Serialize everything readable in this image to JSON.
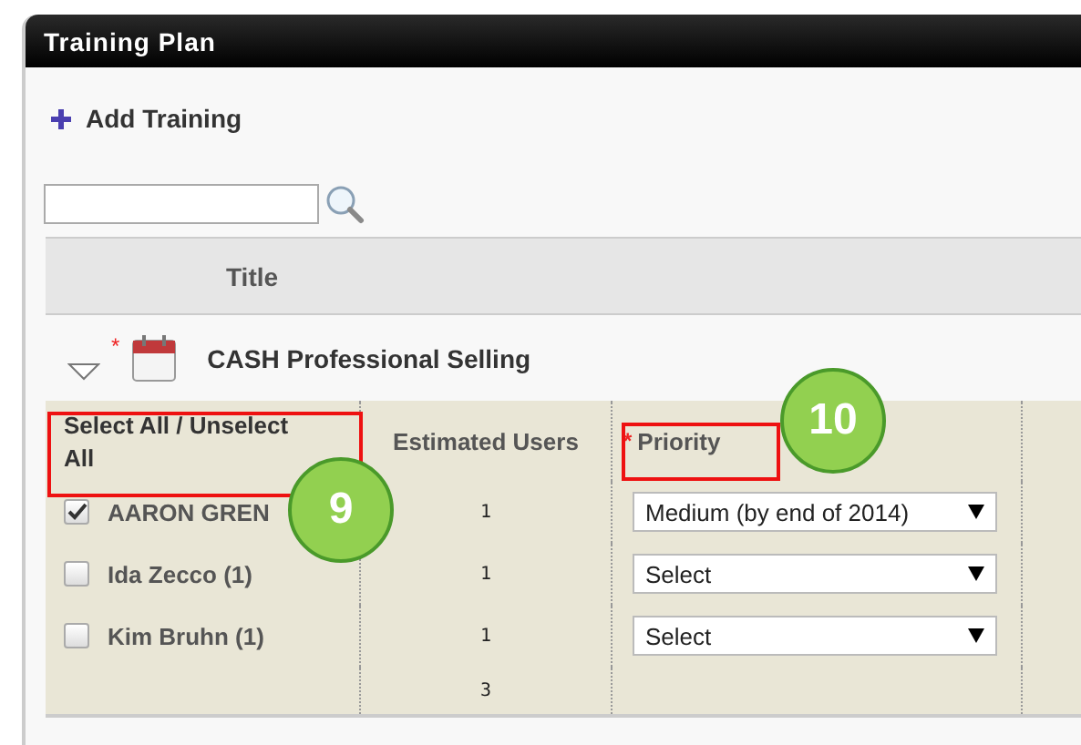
{
  "panel": {
    "title": "Training Plan"
  },
  "add_link": {
    "label": "Add Training"
  },
  "table": {
    "columns": [
      "Title"
    ],
    "training": {
      "title": "CASH Professional Selling",
      "required_mark": "*",
      "expanded": true,
      "columns": [
        {
          "label": "Select All / Unselect All"
        },
        {
          "label": "Estimated Users"
        },
        {
          "label": "Priority",
          "required_mark": "*"
        }
      ],
      "rows": [
        {
          "name": "AARON GREN",
          "checked": true,
          "users": "1",
          "priority": "Medium (by end of 2014)"
        },
        {
          "name": "Ida Zecco (1)",
          "checked": false,
          "users": "1",
          "priority": "Select"
        },
        {
          "name": "Kim Bruhn (1)",
          "checked": false,
          "users": "1",
          "priority": "Select"
        }
      ],
      "total": "3"
    }
  },
  "callouts": [
    {
      "label": "9"
    },
    {
      "label": "10"
    }
  ]
}
